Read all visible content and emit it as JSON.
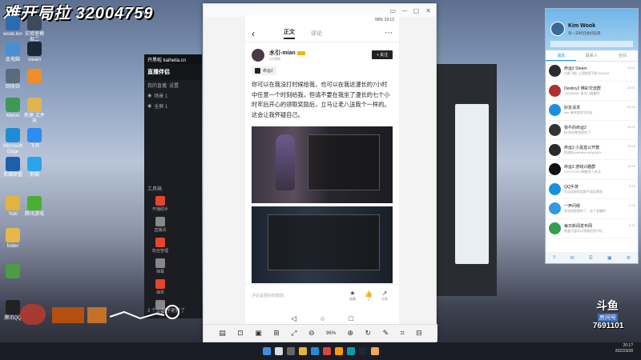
{
  "overlay": {
    "banner": "难开局拉 32004759"
  },
  "desktop_icons": [
    {
      "label": "wook.lon",
      "color": "#2b6cb0"
    },
    {
      "label": "实验室模拟二",
      "color": "#3c4a5c"
    },
    {
      "label": "此电脑",
      "color": "#4a90d0"
    },
    {
      "label": "steam",
      "color": "#1b2838"
    },
    {
      "label": "回收站",
      "color": "#5a6b7c"
    },
    {
      "label": "",
      "color": "#f28c28"
    },
    {
      "label": "Melon",
      "color": "#3b9a55"
    },
    {
      "label": "新建 文件夹",
      "color": "#e0b450"
    },
    {
      "label": "Microsoft Edge",
      "color": "#1f8dd6"
    },
    {
      "label": "飞书",
      "color": "#2d8cf0"
    },
    {
      "label": "英雄联盟",
      "color": "#1d5fa8"
    },
    {
      "label": "剪辑",
      "color": "#2aa3ef"
    },
    {
      "label": "Yuki",
      "color": "#e4b33b"
    },
    {
      "label": "腾讯游戏",
      "color": "#47b035"
    },
    {
      "label": "folder",
      "color": "#e7b748"
    },
    {
      "label": "",
      "color": "#4b9c45"
    },
    {
      "label": "腾讯QQ",
      "color": "#222222"
    }
  ],
  "streamer": {
    "topbar": "开黑啦 kaiheila.cn",
    "title": "直播伴侣",
    "menu": [
      "我的直播",
      "设置"
    ],
    "scenes": [
      "场景 1",
      "全屏 1"
    ],
    "section": "工具箱",
    "tools": [
      "开播助手",
      "直播间",
      "粉丝管理",
      "弹幕",
      "抽奖",
      "连麦"
    ],
    "notice": "3 个小程序更新了"
  },
  "phone_window": {
    "controls": [
      "▭",
      "─",
      "▢",
      "✕"
    ],
    "status_left": "",
    "status_right": "58%  19:12",
    "tabs": [
      "正文",
      "评论"
    ],
    "author": {
      "name": "水引-mian",
      "sub": "2分钟前",
      "follow": "+ 关注"
    },
    "game_tag": "命运2",
    "post_text": "你可以在我没打时候给我，也可以在我这漫长的7小时中任意一个时刻给我，但请不要在我坐了漫长的七个小时牢后开心的领取奖励后，立马让老八送我个一样的。这会让我怀疑自己。",
    "comment_placeholder": "评论是更好的鼓励",
    "actions": [
      {
        "icon": "★",
        "label": "收藏"
      },
      {
        "icon": "👍",
        "label": "1"
      },
      {
        "icon": "↗",
        "label": "分享"
      }
    ],
    "nav": [
      "◁",
      "○",
      "□"
    ],
    "toolbar": {
      "icons": [
        "screenshot",
        "capture",
        "record",
        "fit",
        "expand",
        "zoom-out"
      ],
      "zoom": "96%",
      "icons_right": [
        "zoom-in",
        "rotate",
        "edit",
        "crop",
        "pin"
      ]
    }
  },
  "qq": {
    "name": "Kim Wook",
    "signature": "有一天终究会好起来",
    "tabs": [
      "消息",
      "联系人",
      "空间"
    ],
    "conversations": [
      {
        "name": "命运2 Steam",
        "msg": "白昼飞船 上班狗是不是?#42341",
        "time": "20:01",
        "color": "#2c2c2c"
      },
      {
        "name": "Destiny2 精彩交流群",
        "msg": "小白@kim: 说点儿趣事呗",
        "time": "20:01",
        "color": "#b03030"
      },
      {
        "name": "好友请求",
        "msg": "kim 请求加你为好友",
        "time": "20:32",
        "color": "#1a8fe0"
      },
      {
        "name": "铁牛的命运2",
        "msg": "你:你在哪里呢你了",
        "time": "20:30",
        "color": "#333333"
      },
      {
        "name": "命运2 小黑盒公开群",
        "msg": "群通知:kaiheila.cn/0g34kY",
        "time": "20:05",
        "color": "#2a2a2a"
      },
      {
        "name": "命运2 游戏兴趣群",
        "msg": "小小小小5-3周爽多人关注",
        "time": "19:49",
        "color": "#111111"
      },
      {
        "name": "QQ手游",
        "msg": "大运动前的奖励手游没想发...",
        "time": "3-24",
        "color": "#1a8fe0"
      },
      {
        "name": "一声问候",
        "msg": "发送给那里的了，这个有趣的",
        "time": "3-23",
        "color": "#2f9ae0"
      },
      {
        "name": "每日新闻发布网",
        "msg": "那盒子部分以等级信息可玩",
        "time": "3-21",
        "color": "#30a050"
      }
    ],
    "footer_icons": [
      "≡",
      "✉",
      "☰",
      "▣",
      "⚙"
    ]
  },
  "douyu": {
    "logo": "斗鱼",
    "room_label": "房间号",
    "room_number": "7691101"
  },
  "taskbar": {
    "time": "20:1?",
    "date": "2022/3/28"
  }
}
